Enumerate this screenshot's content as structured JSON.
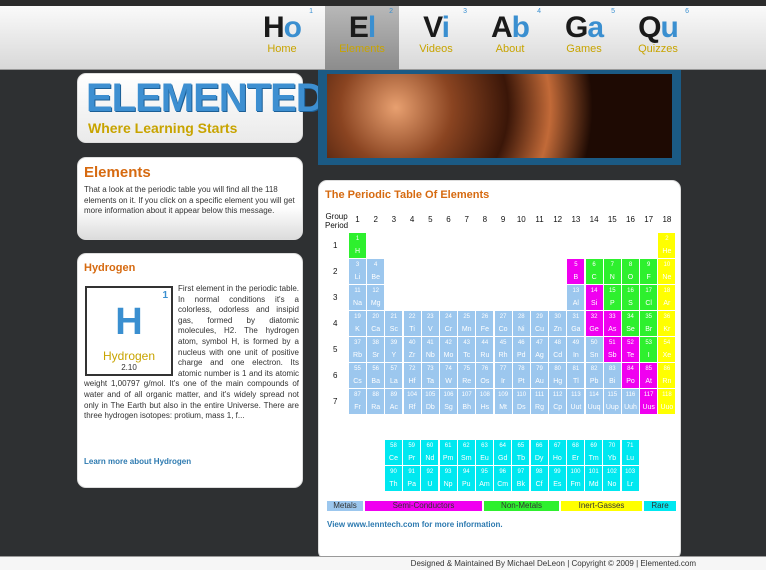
{
  "nav": {
    "tabs": [
      {
        "sym1": "H",
        "sym2": "o",
        "label": "Home",
        "num": "1",
        "active": false
      },
      {
        "sym1": "E",
        "sym2": "l",
        "label": "Elements",
        "num": "2",
        "active": true
      },
      {
        "sym1": "V",
        "sym2": "i",
        "label": "Videos",
        "num": "3",
        "active": false
      },
      {
        "sym1": "A",
        "sym2": "b",
        "label": "About",
        "num": "4",
        "active": false
      },
      {
        "sym1": "G",
        "sym2": "a",
        "label": "Games",
        "num": "5",
        "active": false
      },
      {
        "sym1": "Q",
        "sym2": "u",
        "label": "Quizzes",
        "num": "6",
        "active": false
      }
    ]
  },
  "logo": {
    "word": "ELEMENTED",
    "tagline": "Where Learning Starts"
  },
  "about": {
    "title": "Elements",
    "text": "That a look at the periodic table you will find all the 118 elements on it. If you click on a specific element you will get more information about it appear below this message."
  },
  "hydrogen": {
    "title": "Hydrogen",
    "number": "1",
    "symbol": "H",
    "name": "Hydrogen",
    "weight": "2.10",
    "text": "First element in the periodic table. In normal conditions it's a colorless, odorless and insipid gas, formed by diatomic molecules, H2. The hydrogen atom, symbol H, is formed by a nucleus with one unit of positive charge and one electron. Its atomic number is 1 and its atomic weight 1,00797 g/mol. It's one of the main compounds of water and of all organic matter, and it's widely spread not only in The Earth but also in the entire Universe. There are three hydrogen isotopes: protium, mass 1, f...",
    "more": "Learn more about Hydrogen"
  },
  "table": {
    "title": "The Periodic Table Of Elements",
    "group_label": "Group",
    "period_label": "Period",
    "groups": [
      "1",
      "2",
      "3",
      "4",
      "5",
      "6",
      "7",
      "8",
      "9",
      "10",
      "11",
      "12",
      "13",
      "14",
      "15",
      "16",
      "17",
      "18"
    ],
    "periods": [
      "1",
      "2",
      "3",
      "4",
      "5",
      "6",
      "7"
    ],
    "colors": {
      "metal": "#9cc7ee",
      "semi": "#f000f0",
      "nonmetal": "#2ef02e",
      "inert": "#ffff00",
      "rare": "#00e8f0"
    },
    "elements": [
      [
        "1",
        "H",
        1,
        1,
        "nonmetal"
      ],
      [
        "2",
        "He",
        1,
        18,
        "inert"
      ],
      [
        "3",
        "Li",
        2,
        1,
        "metal"
      ],
      [
        "4",
        "Be",
        2,
        2,
        "metal"
      ],
      [
        "5",
        "B",
        2,
        13,
        "semi"
      ],
      [
        "6",
        "C",
        2,
        14,
        "nonmetal"
      ],
      [
        "7",
        "N",
        2,
        15,
        "nonmetal"
      ],
      [
        "8",
        "O",
        2,
        16,
        "nonmetal"
      ],
      [
        "9",
        "F",
        2,
        17,
        "nonmetal"
      ],
      [
        "10",
        "Ne",
        2,
        18,
        "inert"
      ],
      [
        "11",
        "Na",
        3,
        1,
        "metal"
      ],
      [
        "12",
        "Mg",
        3,
        2,
        "metal"
      ],
      [
        "13",
        "Al",
        3,
        13,
        "metal"
      ],
      [
        "14",
        "Si",
        3,
        14,
        "semi"
      ],
      [
        "15",
        "P",
        3,
        15,
        "nonmetal"
      ],
      [
        "16",
        "S",
        3,
        16,
        "nonmetal"
      ],
      [
        "17",
        "Cl",
        3,
        17,
        "nonmetal"
      ],
      [
        "18",
        "Ar",
        3,
        18,
        "inert"
      ],
      [
        "19",
        "K",
        4,
        1,
        "metal"
      ],
      [
        "20",
        "Ca",
        4,
        2,
        "metal"
      ],
      [
        "21",
        "Sc",
        4,
        3,
        "metal"
      ],
      [
        "22",
        "Ti",
        4,
        4,
        "metal"
      ],
      [
        "23",
        "V",
        4,
        5,
        "metal"
      ],
      [
        "24",
        "Cr",
        4,
        6,
        "metal"
      ],
      [
        "25",
        "Mn",
        4,
        7,
        "metal"
      ],
      [
        "26",
        "Fe",
        4,
        8,
        "metal"
      ],
      [
        "27",
        "Co",
        4,
        9,
        "metal"
      ],
      [
        "28",
        "Ni",
        4,
        10,
        "metal"
      ],
      [
        "29",
        "Cu",
        4,
        11,
        "metal"
      ],
      [
        "30",
        "Zn",
        4,
        12,
        "metal"
      ],
      [
        "31",
        "Ga",
        4,
        13,
        "metal"
      ],
      [
        "32",
        "Ge",
        4,
        14,
        "semi"
      ],
      [
        "33",
        "As",
        4,
        15,
        "semi"
      ],
      [
        "34",
        "Se",
        4,
        16,
        "nonmetal"
      ],
      [
        "35",
        "Br",
        4,
        17,
        "nonmetal"
      ],
      [
        "36",
        "Kr",
        4,
        18,
        "inert"
      ],
      [
        "37",
        "Rb",
        5,
        1,
        "metal"
      ],
      [
        "38",
        "Sr",
        5,
        2,
        "metal"
      ],
      [
        "39",
        "Y",
        5,
        3,
        "metal"
      ],
      [
        "40",
        "Zr",
        5,
        4,
        "metal"
      ],
      [
        "41",
        "Nb",
        5,
        5,
        "metal"
      ],
      [
        "42",
        "Mo",
        5,
        6,
        "metal"
      ],
      [
        "43",
        "Tc",
        5,
        7,
        "metal"
      ],
      [
        "44",
        "Ru",
        5,
        8,
        "metal"
      ],
      [
        "45",
        "Rh",
        5,
        9,
        "metal"
      ],
      [
        "46",
        "Pd",
        5,
        10,
        "metal"
      ],
      [
        "47",
        "Ag",
        5,
        11,
        "metal"
      ],
      [
        "48",
        "Cd",
        5,
        12,
        "metal"
      ],
      [
        "49",
        "In",
        5,
        13,
        "metal"
      ],
      [
        "50",
        "Sn",
        5,
        14,
        "metal"
      ],
      [
        "51",
        "Sb",
        5,
        15,
        "semi"
      ],
      [
        "52",
        "Te",
        5,
        16,
        "semi"
      ],
      [
        "53",
        "I",
        5,
        17,
        "nonmetal"
      ],
      [
        "54",
        "Xe",
        5,
        18,
        "inert"
      ],
      [
        "55",
        "Cs",
        6,
        1,
        "metal"
      ],
      [
        "56",
        "Ba",
        6,
        2,
        "metal"
      ],
      [
        "57",
        "La",
        6,
        3,
        "metal"
      ],
      [
        "72",
        "Hf",
        6,
        4,
        "metal"
      ],
      [
        "73",
        "Ta",
        6,
        5,
        "metal"
      ],
      [
        "74",
        "W",
        6,
        6,
        "metal"
      ],
      [
        "75",
        "Re",
        6,
        7,
        "metal"
      ],
      [
        "76",
        "Os",
        6,
        8,
        "metal"
      ],
      [
        "77",
        "Ir",
        6,
        9,
        "metal"
      ],
      [
        "78",
        "Pt",
        6,
        10,
        "metal"
      ],
      [
        "79",
        "Au",
        6,
        11,
        "metal"
      ],
      [
        "80",
        "Hg",
        6,
        12,
        "metal"
      ],
      [
        "81",
        "Tl",
        6,
        13,
        "metal"
      ],
      [
        "82",
        "Pb",
        6,
        14,
        "metal"
      ],
      [
        "83",
        "Bi",
        6,
        15,
        "metal"
      ],
      [
        "84",
        "Po",
        6,
        16,
        "semi"
      ],
      [
        "85",
        "At",
        6,
        17,
        "semi"
      ],
      [
        "86",
        "Rn",
        6,
        18,
        "inert"
      ],
      [
        "87",
        "Fr",
        7,
        1,
        "metal"
      ],
      [
        "88",
        "Ra",
        7,
        2,
        "metal"
      ],
      [
        "89",
        "Ac",
        7,
        3,
        "metal"
      ],
      [
        "104",
        "Rf",
        7,
        4,
        "metal"
      ],
      [
        "105",
        "Db",
        7,
        5,
        "metal"
      ],
      [
        "106",
        "Sg",
        7,
        6,
        "metal"
      ],
      [
        "107",
        "Bh",
        7,
        7,
        "metal"
      ],
      [
        "108",
        "Hs",
        7,
        8,
        "metal"
      ],
      [
        "109",
        "Mt",
        7,
        9,
        "metal"
      ],
      [
        "110",
        "Ds",
        7,
        10,
        "metal"
      ],
      [
        "111",
        "Rg",
        7,
        11,
        "metal"
      ],
      [
        "112",
        "Cp",
        7,
        12,
        "metal"
      ],
      [
        "113",
        "Uut",
        7,
        13,
        "metal"
      ],
      [
        "114",
        "Uuq",
        7,
        14,
        "metal"
      ],
      [
        "115",
        "Uup",
        7,
        15,
        "metal"
      ],
      [
        "116",
        "Uuh",
        7,
        16,
        "metal"
      ],
      [
        "117",
        "Uus",
        7,
        17,
        "semi"
      ],
      [
        "118",
        "Uuo",
        7,
        18,
        "inert"
      ]
    ],
    "lanthanides": [
      [
        "58",
        "Ce"
      ],
      [
        "59",
        "Pr"
      ],
      [
        "60",
        "Nd"
      ],
      [
        "61",
        "Pm"
      ],
      [
        "62",
        "Sm"
      ],
      [
        "63",
        "Eu"
      ],
      [
        "64",
        "Gd"
      ],
      [
        "65",
        "Tb"
      ],
      [
        "66",
        "Dy"
      ],
      [
        "67",
        "Ho"
      ],
      [
        "68",
        "Er"
      ],
      [
        "69",
        "Tm"
      ],
      [
        "70",
        "Yb"
      ],
      [
        "71",
        "Lu"
      ]
    ],
    "actinides": [
      [
        "90",
        "Th"
      ],
      [
        "91",
        "Pa"
      ],
      [
        "92",
        "U"
      ],
      [
        "93",
        "Np"
      ],
      [
        "94",
        "Pu"
      ],
      [
        "95",
        "Am"
      ],
      [
        "96",
        "Cm"
      ],
      [
        "97",
        "Bk"
      ],
      [
        "98",
        "Cf"
      ],
      [
        "99",
        "Es"
      ],
      [
        "100",
        "Fm"
      ],
      [
        "101",
        "Md"
      ],
      [
        "102",
        "No"
      ],
      [
        "103",
        "Lr"
      ]
    ],
    "legend": [
      {
        "label": "Metals",
        "key": "metal"
      },
      {
        "label": "Semi-Conductors",
        "key": "semi"
      },
      {
        "label": "Non-Metals",
        "key": "nonmetal"
      },
      {
        "label": "Inert-Gasses",
        "key": "inert"
      },
      {
        "label": "Rare",
        "key": "rare"
      }
    ],
    "source": "View www.lenntech.com for more information."
  },
  "footer": "Designed & Maintained By Michael DeLeon | Copyright © 2009 | Elemented.com"
}
